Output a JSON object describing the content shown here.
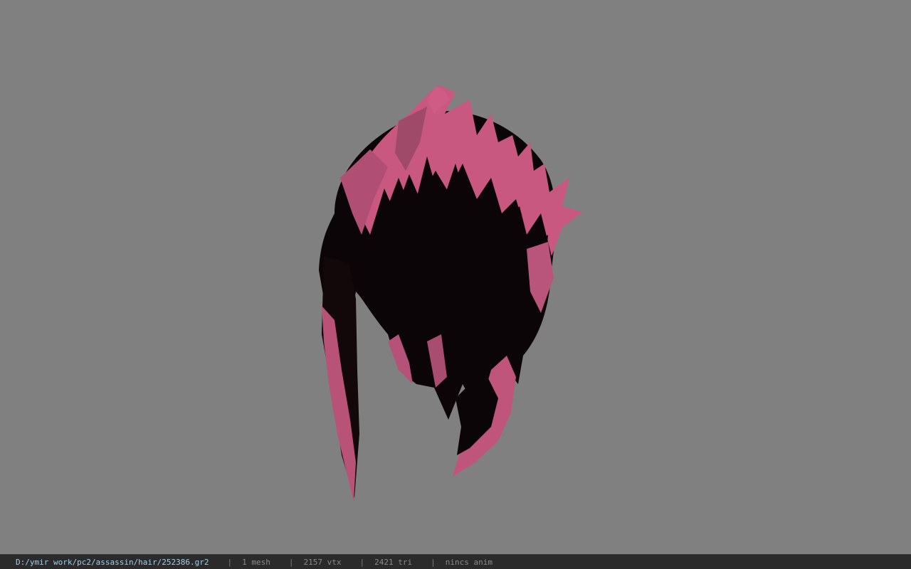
{
  "status_bar": {
    "file_path": "D:/ymir work/pc2/assassin/hair/252386.gr2",
    "separator": "|",
    "mesh_count": "1 mesh",
    "vertex_count": "2157 vtx",
    "triangle_count": "2421 tri",
    "animation": "nincs anim"
  },
  "colors": {
    "viewport_background": "#808080",
    "hair_pink": "#c8557d",
    "hair_dark": "#0a0406",
    "status_bar_background": "#2b2b2b",
    "path_text": "#9fd0e8"
  }
}
